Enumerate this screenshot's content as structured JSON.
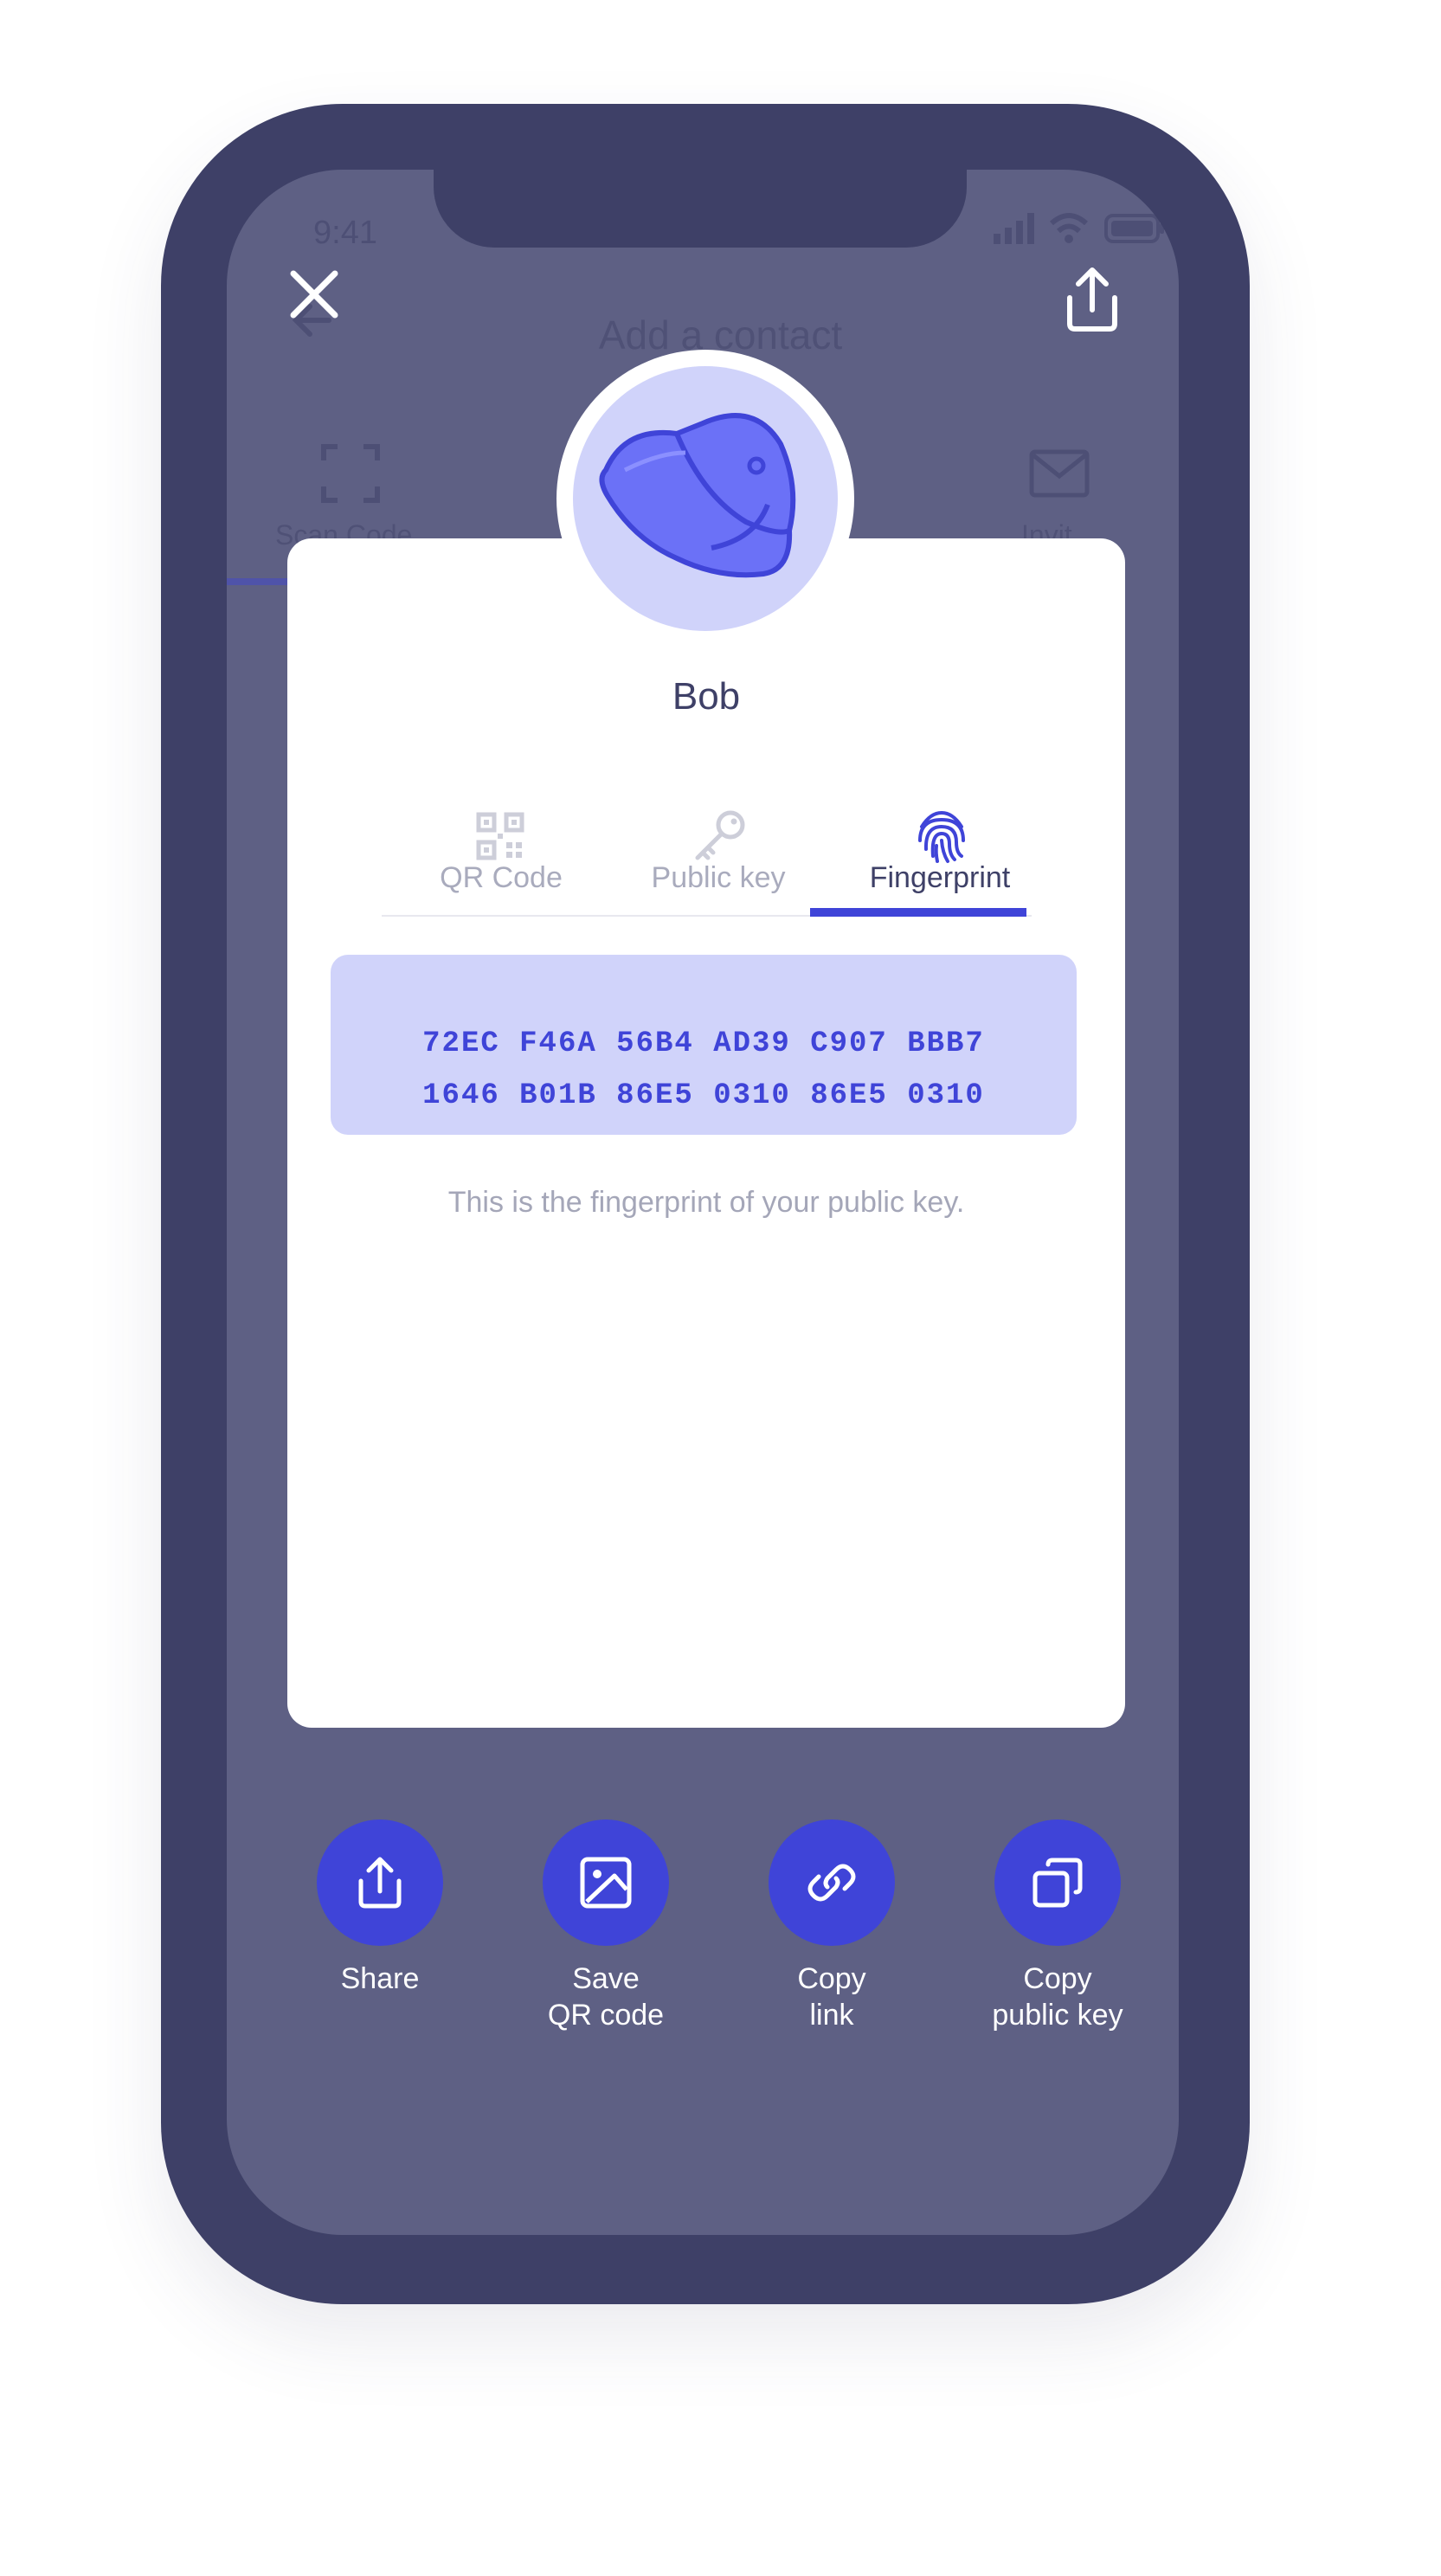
{
  "status_bar": {
    "time": "9:41"
  },
  "background_screen": {
    "title": "Add a contact",
    "tabs": [
      {
        "label": "Scan Code"
      },
      {
        "label": "Invit"
      }
    ]
  },
  "contact": {
    "name": "Bob"
  },
  "tabs": [
    {
      "label": "QR Code",
      "icon": "qr-code-icon",
      "active": false
    },
    {
      "label": "Public key",
      "icon": "key-icon",
      "active": false
    },
    {
      "label": "Fingerprint",
      "icon": "fingerprint-icon",
      "active": true
    }
  ],
  "fingerprint": {
    "line1": "72EC F46A 56B4 AD39 C907 BBB7",
    "line2": "1646 B01B 86E5 0310 86E5 0310",
    "caption": "This is the fingerprint of your public key."
  },
  "actions": [
    {
      "line1": "Share",
      "line2": "",
      "icon": "share-icon"
    },
    {
      "line1": "Save",
      "line2": "QR code",
      "icon": "image-icon"
    },
    {
      "line1": "Copy",
      "line2": "link",
      "icon": "link-icon"
    },
    {
      "line1": "Copy",
      "line2": "public key",
      "icon": "copy-icon"
    }
  ],
  "colors": {
    "accent": "#3f44d8",
    "overlay": "#5e6084",
    "phone_frame": "#3e4067",
    "fingerprint_bg": "#d0d3fa"
  }
}
